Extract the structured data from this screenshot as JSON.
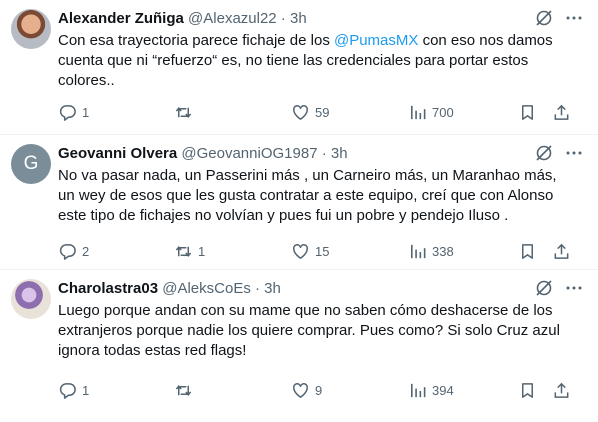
{
  "tweets": [
    {
      "avatar_initial": "",
      "name": "Alexander Zuñiga",
      "handle": "@Alexazul22",
      "time": "3h",
      "text_lines": [
        [
          "Con esa trayectoria parece fichaje de los ",
          "@PumasMX",
          " con eso nos damos"
        ],
        "cuenta que ni “refuerzo“ es, no tiene las credenciales para portar estos",
        "colores.."
      ],
      "replies": "1",
      "reposts": "",
      "likes": "59",
      "views": "700"
    },
    {
      "avatar_initial": "G",
      "name": "Geovanni Olvera",
      "handle": "@GeovanniOG1987",
      "time": "3h",
      "text_lines": [
        "No va pasar nada, un Passerini más , un Carneiro más, un Maranhao más,",
        "un wey de esos que les gusta contratar a este equipo, creí que con Alonso",
        "este tipo de fichajes no volvían y pues fui un pobre y pendejo Iluso ."
      ],
      "replies": "2",
      "reposts": "1",
      "likes": "15",
      "views": "338"
    },
    {
      "avatar_initial": "",
      "name": "Charolastra03",
      "handle": "@AleksCoEs",
      "time": "3h",
      "text_lines": [
        "Luego porque andan con su mame que no saben cómo deshacerse de los",
        "extranjeros porque nadie los quiere comprar. Pues como? Si solo Cruz azul",
        "ignora todas estas red flags!"
      ],
      "replies": "1",
      "reposts": "",
      "likes": "9",
      "views": "394"
    }
  ],
  "separator": " · ",
  "colors": {
    "text": "#0f1419",
    "secondary": "#536471",
    "link": "#1d9bf0",
    "divider": "#eff3f4"
  },
  "icons": {
    "reply": "reply-icon",
    "repost": "repost-icon",
    "like": "like-icon",
    "views": "views-icon",
    "bookmark": "bookmark-icon",
    "share": "share-icon",
    "grok": "grok-icon",
    "more": "more-icon"
  }
}
